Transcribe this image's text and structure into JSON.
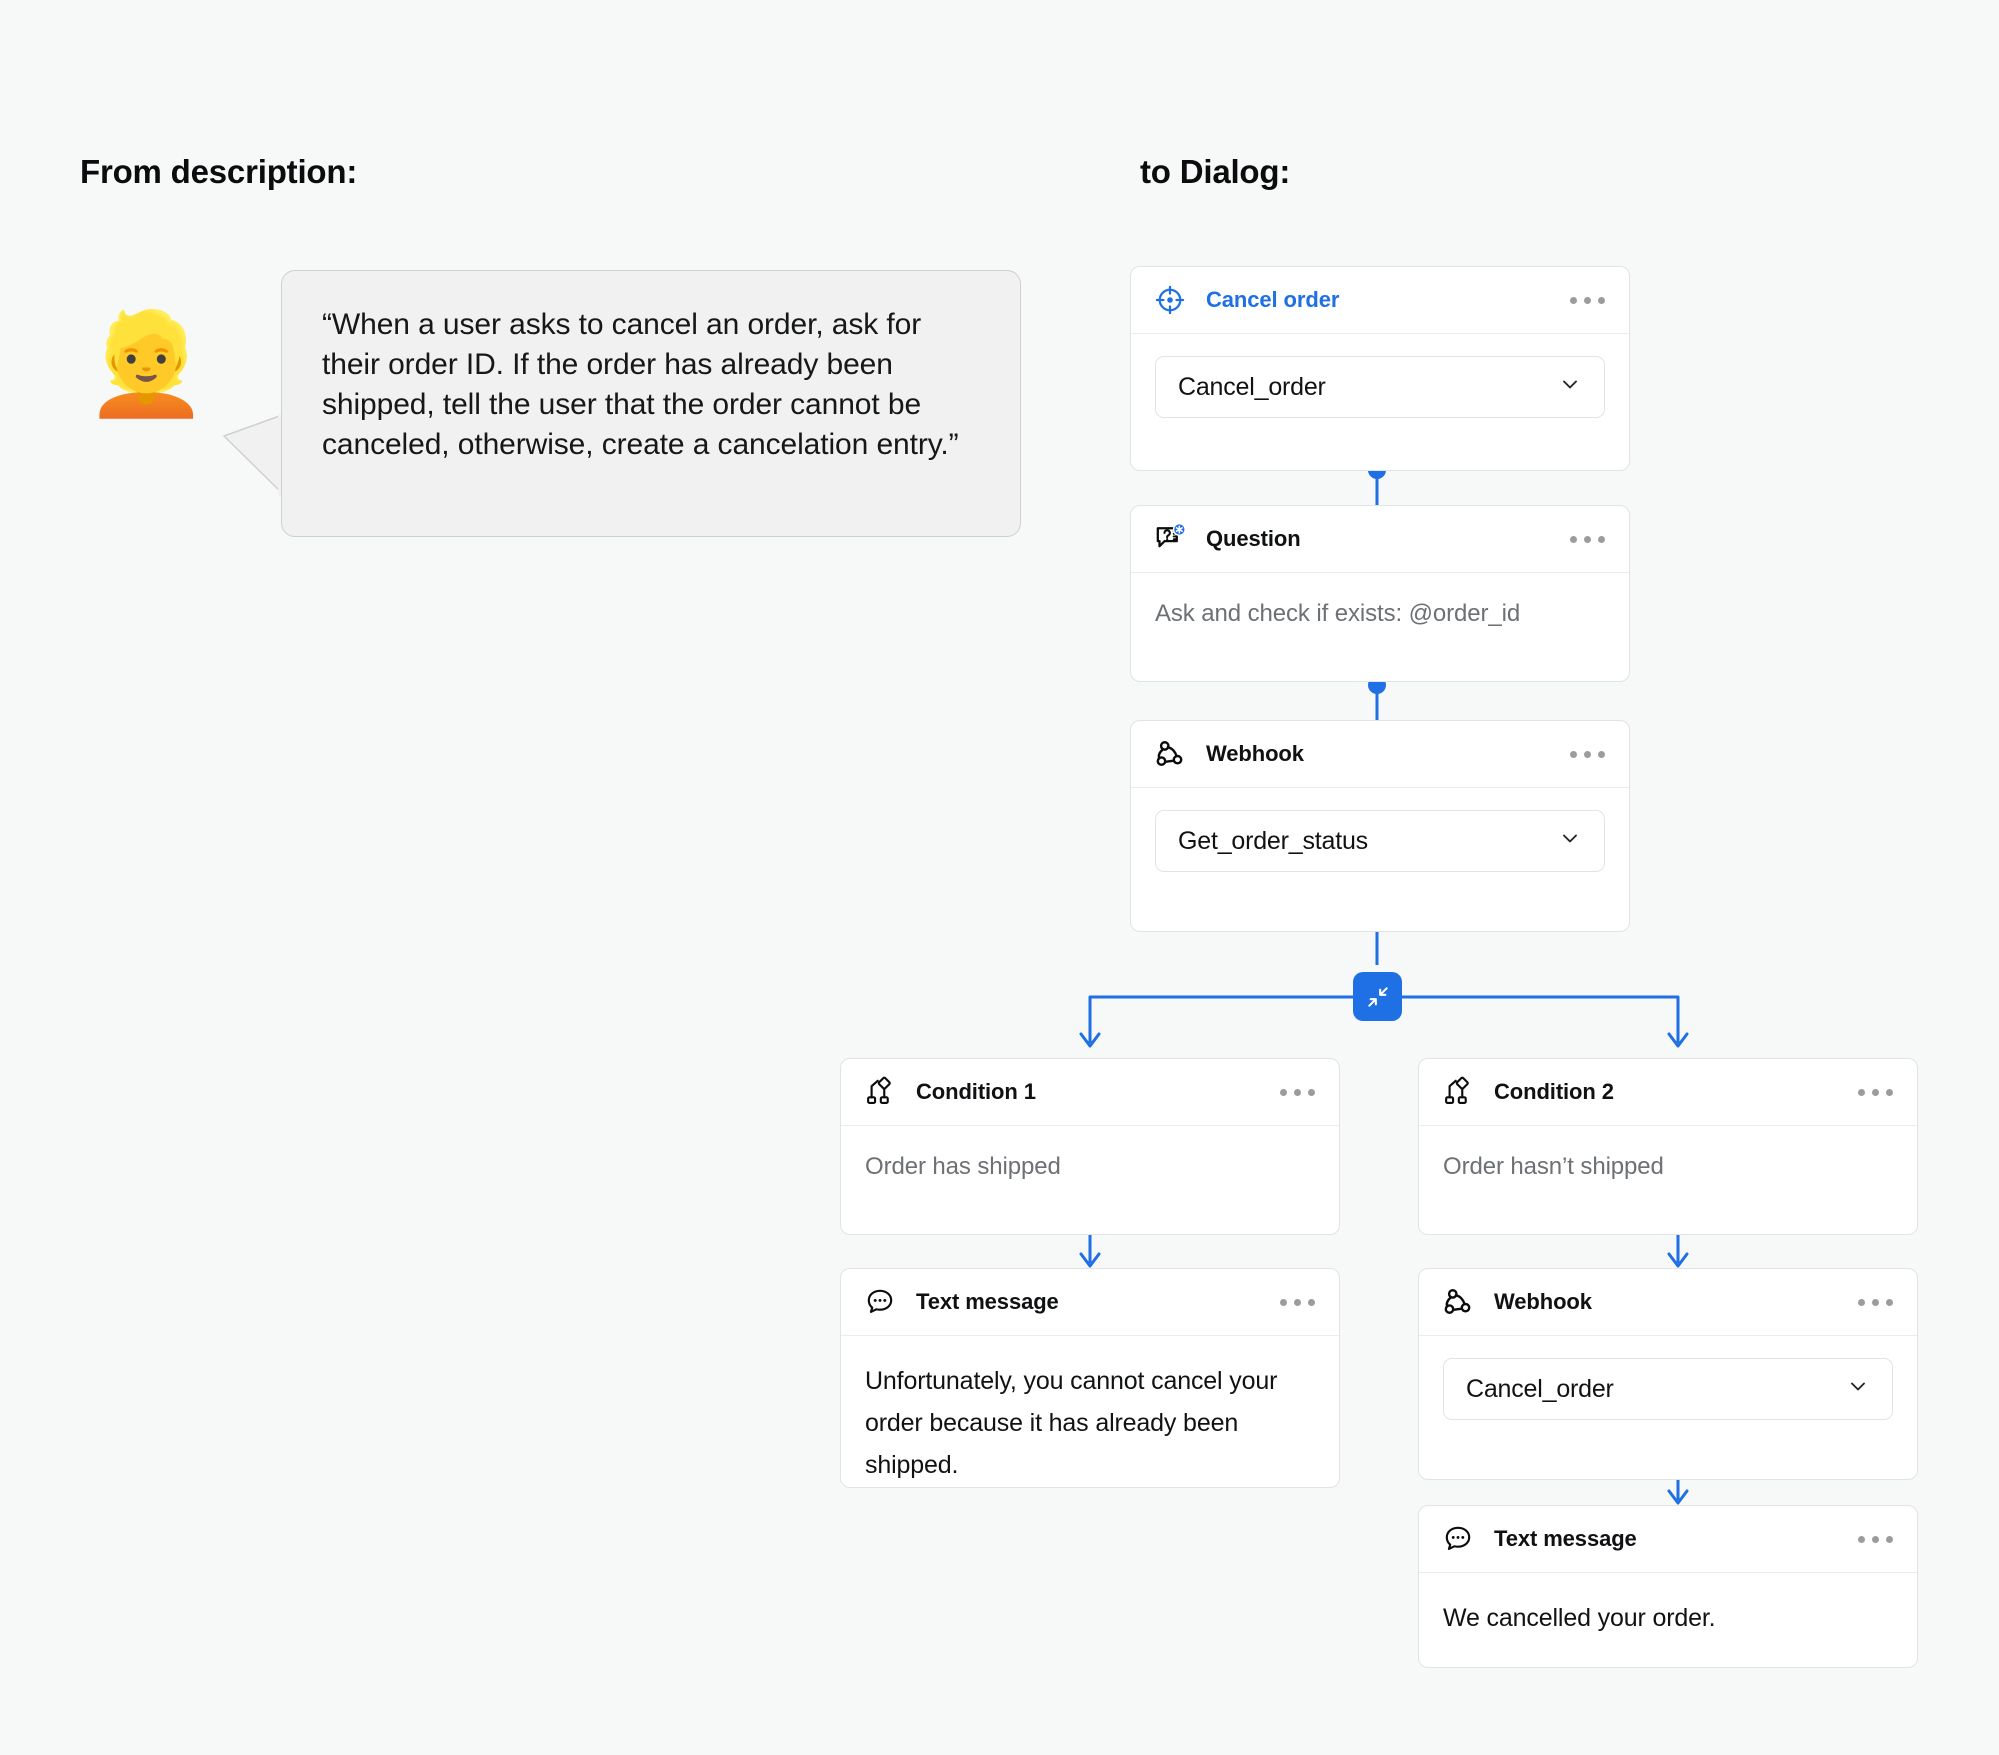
{
  "headings": {
    "left": "From description:",
    "right": "to Dialog:"
  },
  "persona": {
    "avatar_glyph": "👱",
    "quote": "“When a user asks to cancel an order, ask for their order ID. If the order has already been shipped, tell the user that the order cannot be canceled, otherwise, create a cancelation entry.”"
  },
  "flow": {
    "accent_color": "#1f6fe5",
    "merge_button": {
      "icon": "collapse-arrows-icon",
      "label": ""
    },
    "nodes": {
      "intent": {
        "icon": "target-icon",
        "title": "Cancel order",
        "select_value": "Cancel_order",
        "chevron": "chevron-down-icon",
        "menu": "more-options-icon"
      },
      "question": {
        "icon": "question-bubble-icon",
        "title": "Question",
        "body": "Ask and check if exists: @order_id",
        "menu": "more-options-icon"
      },
      "webhook_status": {
        "icon": "webhook-icon",
        "title": "Webhook",
        "select_value": "Get_order_status",
        "chevron": "chevron-down-icon",
        "menu": "more-options-icon"
      },
      "condition_1": {
        "icon": "condition-branch-icon",
        "title": "Condition 1",
        "body": "Order has shipped",
        "menu": "more-options-icon"
      },
      "condition_2": {
        "icon": "condition-branch-icon",
        "title": "Condition 2",
        "body": "Order hasn’t shipped",
        "menu": "more-options-icon"
      },
      "text_left": {
        "icon": "chat-bubble-icon",
        "title": "Text message",
        "body": "Unfortunately, you cannot cancel your order because it has already been shipped.",
        "menu": "more-options-icon"
      },
      "webhook_cancel": {
        "icon": "webhook-icon",
        "title": "Webhook",
        "select_value": "Cancel_order",
        "chevron": "chevron-down-icon",
        "menu": "more-options-icon"
      },
      "text_right": {
        "icon": "chat-bubble-icon",
        "title": "Text message",
        "body": "We cancelled your order.",
        "menu": "more-options-icon"
      }
    }
  }
}
